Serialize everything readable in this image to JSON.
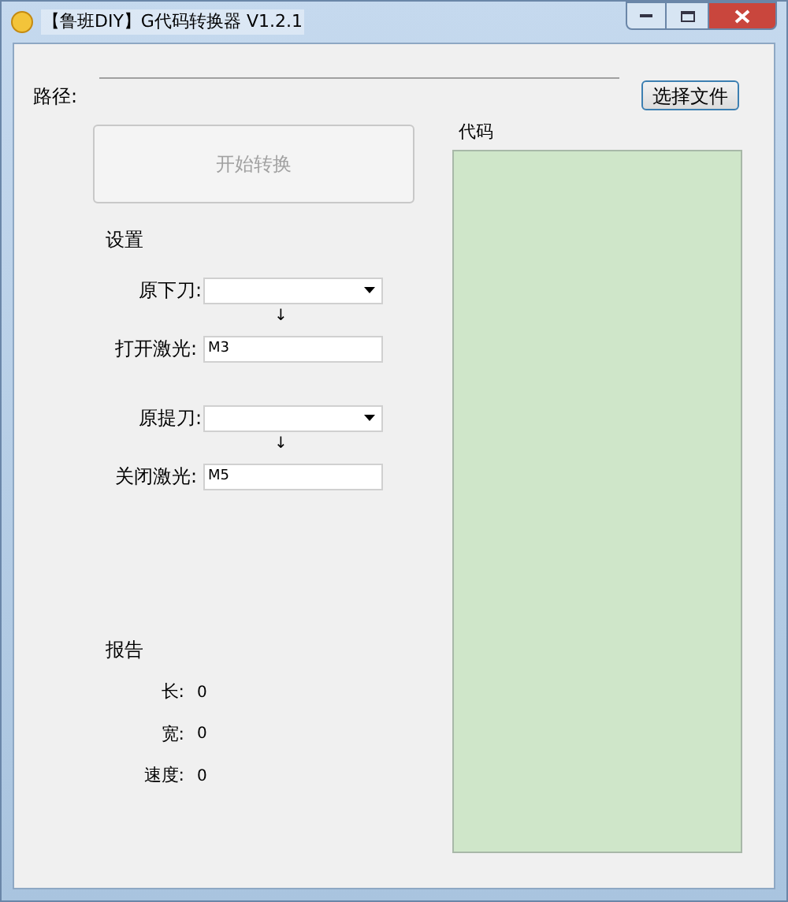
{
  "window": {
    "title": "【鲁班DIY】G代码转换器 V1.2.1"
  },
  "path": {
    "label": "路径:"
  },
  "choose_button": {
    "label": "选择文件"
  },
  "start_button": {
    "label": "开始转换",
    "disabled": true
  },
  "settings": {
    "title": "设置",
    "groups": [
      {
        "dropdown_label": "原下刀:",
        "arrow": "↓",
        "input_label": "打开激光:",
        "value": "M3"
      },
      {
        "dropdown_label": "原提刀:",
        "arrow": "↓",
        "input_label": "关闭激光:",
        "value": "M5"
      }
    ]
  },
  "report": {
    "title": "报告",
    "rows": [
      {
        "label": "长:",
        "value": "0"
      },
      {
        "label": "宽:",
        "value": "0"
      },
      {
        "label": "速度:",
        "value": "0"
      }
    ]
  },
  "code": {
    "label": "代码"
  }
}
